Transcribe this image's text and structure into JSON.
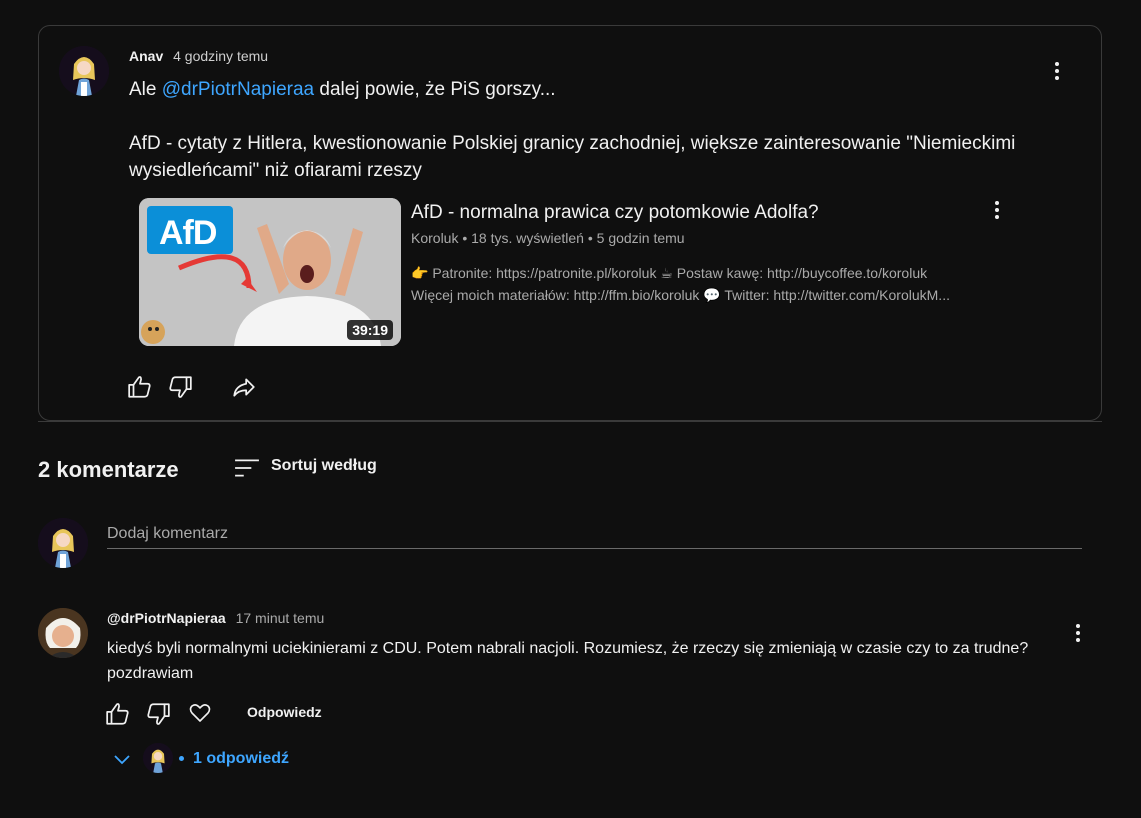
{
  "post": {
    "author": "Anav",
    "time": "4 godziny temu",
    "text_prefix": "Ale ",
    "mention": "@drPiotrNapieraa",
    "text_suffix": " dalej powie, że PiS gorszy...",
    "paragraph2": "AfD - cytaty z Hitlera, kwestionowanie Polskiej granicy zachodniej, większe zainteresowanie \"Niemieckimi wysiedleńcami\" niż ofiarami rzeszy",
    "video": {
      "logo_text": "AfD",
      "duration": "39:19",
      "title": "AfD - normalna prawica czy potomkowie Adolfa?",
      "meta": "Koroluk • 18 tys. wyświetleń • 5 godzin temu",
      "desc_line1": "👉 Patronite: https://patronite.pl/koroluk ☕ Postaw kawę: http://buycoffee.to/koroluk",
      "desc_line2": "Więcej moich materiałów: http://ffm.bio/koroluk 💬 Twitter: http://twitter.com/KorolukM..."
    }
  },
  "comments_section": {
    "count_label": "2 komentarze",
    "sort_label": "Sortuj według",
    "add_placeholder": "Dodaj komentarz"
  },
  "comment": {
    "author": "@drPiotrNapieraa",
    "time": "17 minut temu",
    "text": "kiedyś byli normalnymi uciekinierami z CDU. Potem nabrali nacjoli. Rozumiesz, że rzeczy się zmieniają w czasie czy to za trudne? pozdrawiam",
    "reply_label": "Odpowiedz",
    "replies_label": "1 odpowiedź"
  },
  "colors": {
    "background": "#0f0f0f",
    "link": "#3ea6ff",
    "border": "#3a3a3a",
    "secondary_text": "#aaaaaa"
  },
  "icons": [
    "kebab-menu-icon",
    "thumb-up-icon",
    "thumb-down-icon",
    "share-icon",
    "sort-icon",
    "heart-icon",
    "chevron-down-icon"
  ]
}
